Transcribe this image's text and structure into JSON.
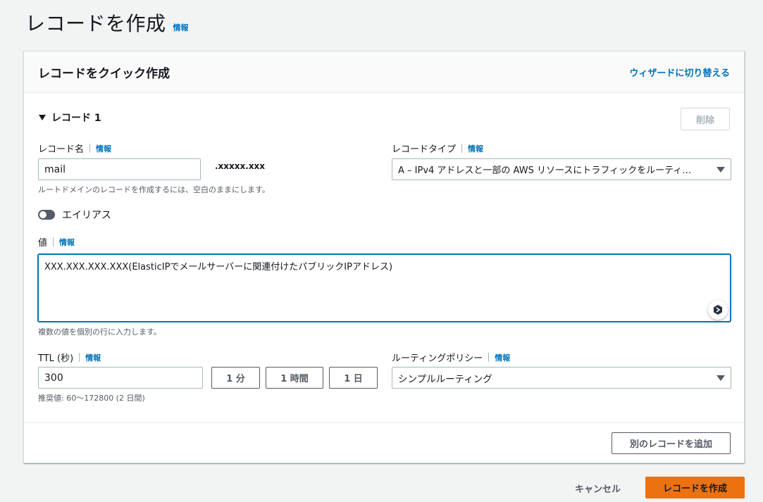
{
  "page": {
    "title": "レコードを作成",
    "info": "情報"
  },
  "panel": {
    "title": "レコードをクイック作成",
    "wizard_link": "ウィザードに切り替える"
  },
  "record": {
    "heading": "レコード 1",
    "delete_label": "削除",
    "name_label": "レコード名",
    "name_info": "情報",
    "name_value": "mail",
    "domain_suffix": ".xxxxx.xxx",
    "name_hint": "ルートドメインのレコードを作成するには、空白のままにします。",
    "type_label": "レコードタイプ",
    "type_info": "情報",
    "type_value": "A – IPv4 アドレスと一部の AWS リソースにトラフィックをルーティ…",
    "alias_label": "エイリアス",
    "value_label": "値",
    "value_info": "情報",
    "value_text": "XXX.XXX.XXX.XXX(ElasticIPでメールサーバーに関連付けたパブリックIPアドレス)",
    "value_hint": "複数の値を個別の行に入力します。",
    "ttl_label": "TTL (秒)",
    "ttl_info": "情報",
    "ttl_value": "300",
    "ttl_1min": "1 分",
    "ttl_1hour": "1 時間",
    "ttl_1day": "1 日",
    "ttl_hint": "推奨値: 60〜172800 (2 日間)",
    "policy_label": "ルーティングポリシー",
    "policy_info": "情報",
    "policy_value": "シンプルルーティング",
    "add_record_label": "別のレコードを追加"
  },
  "footer": {
    "cancel_label": "キャンセル",
    "create_label": "レコードを作成"
  },
  "colors": {
    "accent": "#ec7211",
    "link": "#0073bb",
    "text": "#16191f",
    "background": "#f2f3f3"
  }
}
